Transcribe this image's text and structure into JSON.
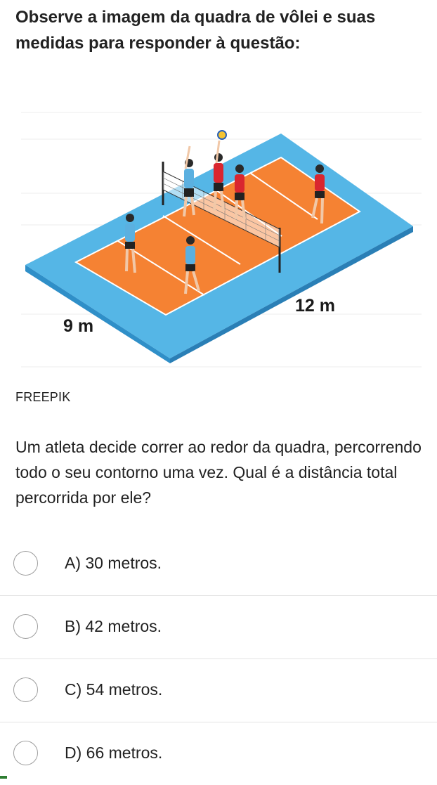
{
  "question": {
    "title": "Observe a imagem da quadra de vôlei e suas medidas para responder à questão:",
    "credit": "FREEPIK",
    "body": "Um atleta decide correr ao redor da quadra, percorrendo todo o seu contorno uma vez. Qual é a distância total percorrida por ele?"
  },
  "image": {
    "width_label": "9 m",
    "length_label": "12 m",
    "colors": {
      "court_base": "#5bb8e8",
      "court_floor": "#f47f35",
      "line": "#ffffff"
    }
  },
  "options": [
    {
      "label": "A) 30 metros."
    },
    {
      "label": "B) 42 metros."
    },
    {
      "label": "C) 54 metros."
    },
    {
      "label": "D) 66 metros."
    }
  ],
  "colors": {
    "text": "#222222",
    "radio_border": "#9e9e9e",
    "divider": "#e3e3e3"
  }
}
